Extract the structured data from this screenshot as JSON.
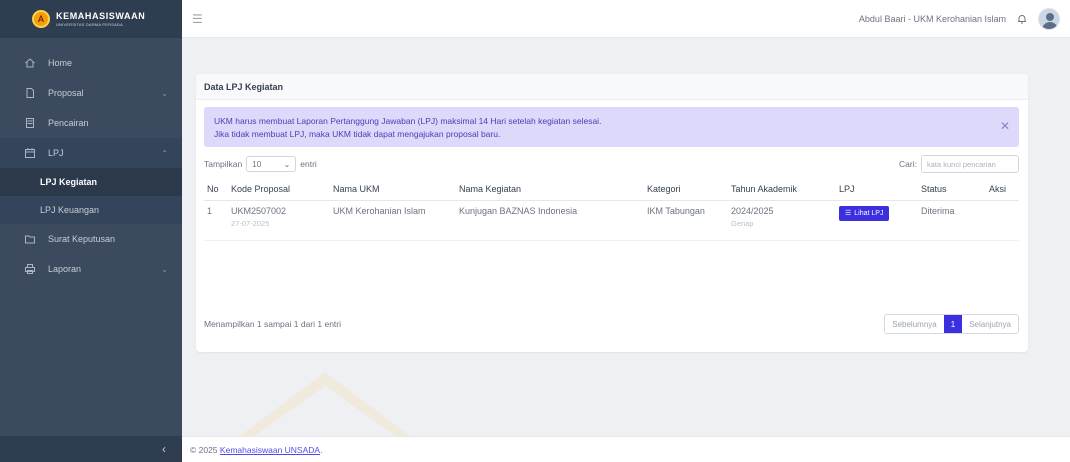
{
  "brand": {
    "title": "KEMAHASISWAAN",
    "subtitle": "UNIVERSITAS DARMA PERSADA",
    "logo_letter": "A"
  },
  "sidebar": {
    "items": [
      {
        "label": "Home",
        "icon": "home-icon"
      },
      {
        "label": "Proposal",
        "icon": "file-icon",
        "has_children": true
      },
      {
        "label": "Pencairan",
        "icon": "calculator-icon"
      },
      {
        "label": "LPJ",
        "icon": "calendar-icon",
        "has_children": true,
        "open": true,
        "children": [
          {
            "label": "LPJ Kegiatan",
            "active": true
          },
          {
            "label": "LPJ Keuangan"
          }
        ]
      },
      {
        "label": "Surat Keputusan",
        "icon": "folder-icon"
      },
      {
        "label": "Laporan",
        "icon": "printer-icon",
        "has_children": true
      }
    ],
    "collapse_glyph": "‹"
  },
  "topbar": {
    "user": "Abdul Baari - UKM Kerohanian Islam"
  },
  "card": {
    "title": "Data LPJ Kegiatan",
    "alert": {
      "line1": "UKM harus membuat Laporan Pertanggung Jawaban (LPJ) maksimal 14 Hari setelah kegiatan selesai.",
      "line2": "Jika tidak membuat LPJ, maka UKM tidak dapat mengajukan proposal baru."
    },
    "length": {
      "prefix": "Tampilkan",
      "value": "10",
      "suffix": "entri"
    },
    "search": {
      "label": "Cari:",
      "placeholder": "kata kunci pencarian"
    },
    "columns": [
      "No",
      "Kode Proposal",
      "Nama UKM",
      "Nama Kegiatan",
      "Kategori",
      "Tahun Akademik",
      "LPJ",
      "Status",
      "Aksi"
    ],
    "rows": [
      {
        "no": "1",
        "kode": "UKM2507002",
        "tanggal": "27-07-2025",
        "ukm": "UKM Kerohanian Islam",
        "kegiatan": "Kunjugan BAZNAS Indonesia",
        "kategori": "IKM Tabungan",
        "tahun": "2024/2025",
        "semester": "Genap",
        "lpj_button": "Lihat LPJ",
        "status": "Diterima",
        "aksi": ""
      }
    ],
    "info": "Menampilkan 1 sampai 1 dari 1 entri",
    "pager": {
      "prev": "Sebelumnya",
      "current": "1",
      "next": "Selanjutnya"
    }
  },
  "footer": {
    "prefix": "© 2025",
    "link": "Kemahasiswaan UNSADA",
    "suffix": "."
  },
  "colors": {
    "sidebar": "#3b4a5e",
    "primary": "#3b2fe0",
    "alert_bg": "#dcd9fb",
    "alert_text": "#4b3fb3"
  }
}
